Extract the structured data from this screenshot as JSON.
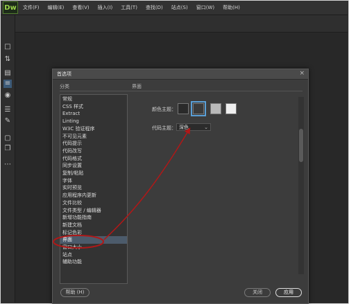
{
  "app": {
    "logo": "Dw"
  },
  "menubar": {
    "items": [
      "文件(F)",
      "编辑(E)",
      "查看(V)",
      "插入(I)",
      "工具(T)",
      "查找(D)",
      "站点(S)",
      "窗口(W)",
      "帮助(H)"
    ]
  },
  "toolbar": {
    "icons": [
      "file-icon",
      "sort-icon",
      "panel-icon",
      "list-icon",
      "target-icon",
      "tree-icon",
      "brush-icon",
      "chat-icon",
      "copy-icon",
      "more-icon"
    ]
  },
  "dialog": {
    "title": "首选项",
    "close": "×",
    "category_header": "分类",
    "pane_header": "界面",
    "categories": [
      "常规",
      "CSS 样式",
      "Extract",
      "Linting",
      "W3C 验证程序",
      "不可见元素",
      "代码提示",
      "代码改写",
      "代码格式",
      "同步设置",
      "复制/粘贴",
      "字体",
      "实时预览",
      "应用程序内更新",
      "文件比较",
      "文件类型 / 编辑器",
      "新增功能指南",
      "新建文档",
      "标记色彩",
      "界面",
      "窗口大小",
      "站点",
      "辅助功能"
    ],
    "selected_category": "界面",
    "color_theme_label": "颜色主题：",
    "color_themes": [
      {
        "name": "darkest",
        "color": "#2a2a2a",
        "selected": false
      },
      {
        "name": "dark",
        "color": "#3a3a3a",
        "selected": true
      },
      {
        "name": "light",
        "color": "#b9b9b9",
        "selected": false
      },
      {
        "name": "lightest",
        "color": "#efefef",
        "selected": false
      }
    ],
    "code_theme_label": "代码主题：",
    "code_theme_value": "深色",
    "code_theme_chevron": "⌄",
    "help_button": "帮助 (H)",
    "close_button": "关闭",
    "apply_button": "应用"
  },
  "annotation": {
    "color": "#b01818"
  }
}
